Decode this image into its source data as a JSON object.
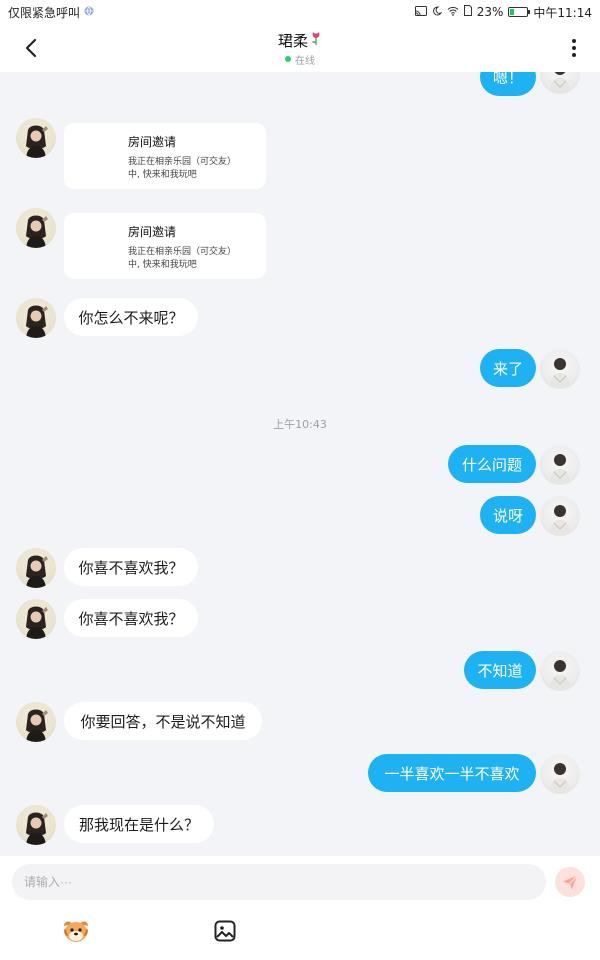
{
  "status_bar": {
    "left_text": "仅限紧急呼叫",
    "battery_percent": "23%",
    "battery_level": 0.23,
    "time": "中午11:14"
  },
  "header": {
    "title": "珺柔",
    "title_icon": "rose-icon",
    "status": "在线"
  },
  "messages": [
    {
      "side": "right",
      "type": "text",
      "text": "嗯！"
    },
    {
      "side": "left",
      "type": "invite",
      "title": "房间邀请",
      "body_line1": "我正在相亲乐园（可交友）",
      "body_line2": "中, 快来和我玩吧"
    },
    {
      "side": "left",
      "type": "invite",
      "title": "房间邀请",
      "body_line1": "我正在相亲乐园（可交友）",
      "body_line2": "中, 快来和我玩吧"
    },
    {
      "side": "left",
      "type": "text",
      "text": "你怎么不来呢？"
    },
    {
      "side": "right",
      "type": "text",
      "text": "来了"
    },
    {
      "type": "time",
      "text": "上午10:43"
    },
    {
      "side": "right",
      "type": "text",
      "text": "什么问题"
    },
    {
      "side": "right",
      "type": "text",
      "text": "说呀"
    },
    {
      "side": "left",
      "type": "text",
      "text": "你喜不喜欢我？"
    },
    {
      "side": "left",
      "type": "text",
      "text": "你喜不喜欢我？"
    },
    {
      "side": "right",
      "type": "text",
      "text": "不知道"
    },
    {
      "side": "left",
      "type": "text",
      "text": "你要回答，不是说不知道"
    },
    {
      "side": "right",
      "type": "text",
      "text": "一半喜欢一半不喜欢"
    },
    {
      "side": "left",
      "type": "text",
      "text": "那我现在是什么？"
    }
  ],
  "composer": {
    "placeholder": "请输入···",
    "value": ""
  },
  "colors": {
    "outgoing_bubble": "#1fb2f2",
    "incoming_bubble": "#ffffff",
    "background": "#f3f4f7",
    "online_dot": "#2ecc71"
  }
}
